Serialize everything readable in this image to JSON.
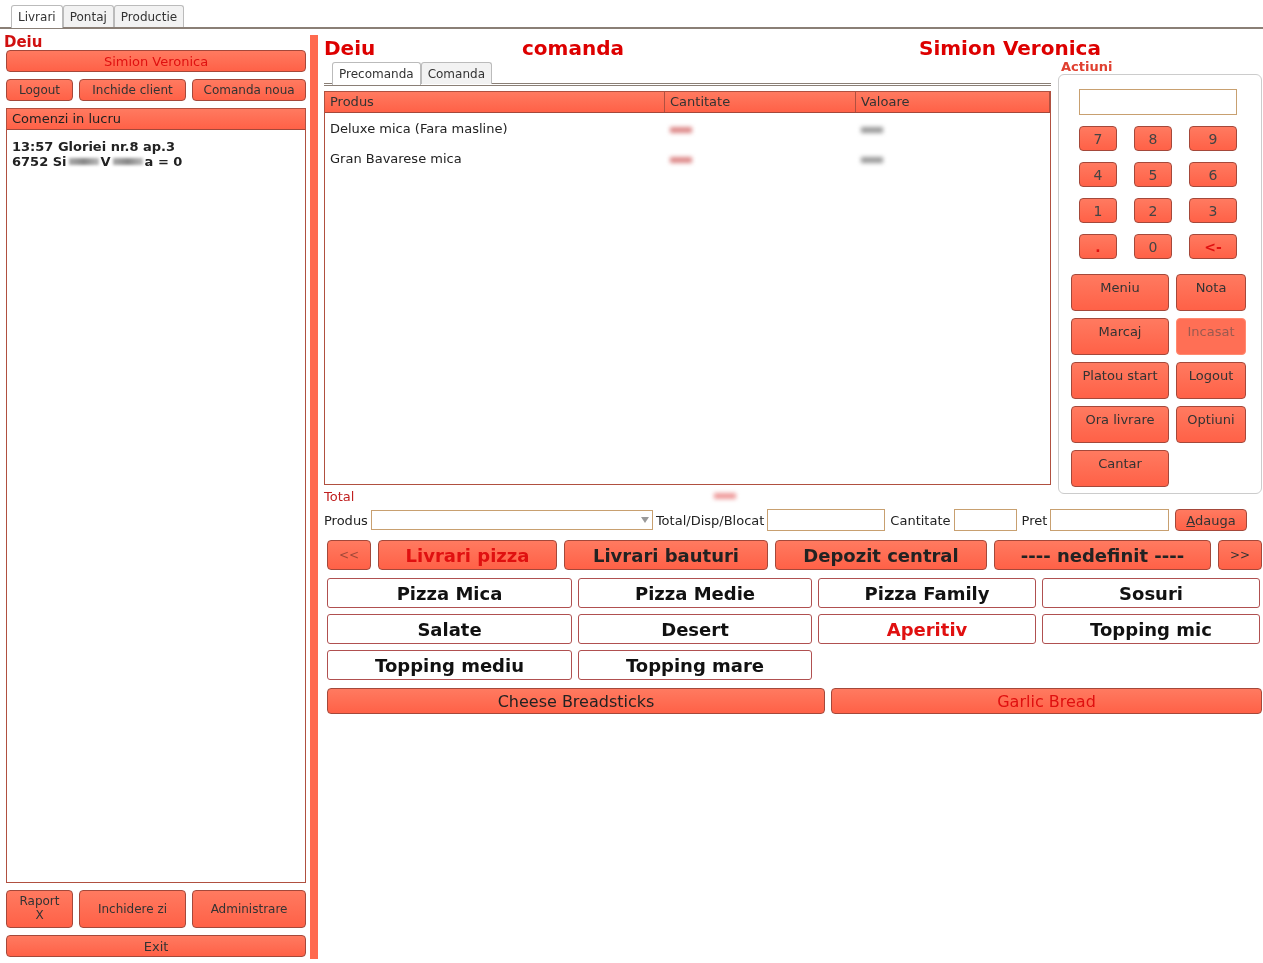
{
  "top_tabs": [
    {
      "label": "Livrari",
      "selected": true
    },
    {
      "label": "Pontaj",
      "selected": false
    },
    {
      "label": "Productie",
      "selected": false
    }
  ],
  "left": {
    "user": "Deiu",
    "operator_button": "Simion Veronica",
    "buttons": [
      "Logout",
      "Inchide client",
      "Comanda noua"
    ],
    "orders_panel": {
      "title": "Comenzi in lucru",
      "orders": [
        {
          "line_1": "13:57 Gloriei nr.8 ap.3",
          "line_2": [
            {
              "kind": "text",
              "text": "6752 Si"
            },
            {
              "kind": "blurred"
            },
            {
              "kind": "text",
              "text": "V"
            },
            {
              "kind": "blurred"
            },
            {
              "kind": "text",
              "text": "a = 0"
            }
          ]
        }
      ]
    },
    "bottom_buttons": [
      "Raport X",
      "Inchidere zi",
      "Administrare"
    ],
    "exit_button": "Exit"
  },
  "header": {
    "user": "Deiu",
    "mode": "comanda",
    "operator": "Simion Veronica"
  },
  "order_tabs": [
    {
      "label": "Precomanda",
      "selected": true
    },
    {
      "label": "Comanda",
      "selected": false
    }
  ],
  "table": {
    "columns": [
      "Produs",
      "Cantitate",
      "Valoare"
    ],
    "rows": [
      {
        "produs": "Deluxe mica (Fara masline)",
        "cantitate": {
          "kind": "blurred"
        },
        "valoare": {
          "kind": "blurred"
        }
      },
      {
        "produs": "Gran Bavarese mica",
        "cantitate": {
          "kind": "blurred"
        },
        "valoare": {
          "kind": "blurred"
        }
      }
    ]
  },
  "total": {
    "label": "Total",
    "value": {
      "kind": "blurred"
    }
  },
  "entry": {
    "produs_label": "Produs",
    "stock_label": "Total/Disp/Blocat",
    "cantitate_label": "Cantitate",
    "pret_label": "Pret",
    "add_button": {
      "label": "Adauga"
    }
  },
  "category_nav": {
    "prev": {
      "label": "<<",
      "disabled": true
    },
    "next": {
      "label": ">>",
      "disabled": false
    },
    "categories": [
      {
        "label": "Livrari pizza",
        "selected": true
      },
      {
        "label": "Livrari bauturi",
        "selected": false
      },
      {
        "label": "Depozit central",
        "selected": false
      },
      {
        "label": "---- nedefinit ----",
        "selected": false
      }
    ]
  },
  "groups": [
    {
      "label": "Pizza Mica",
      "selected": false
    },
    {
      "label": "Pizza Medie",
      "selected": false
    },
    {
      "label": "Pizza Family",
      "selected": false
    },
    {
      "label": "Sosuri",
      "selected": false
    },
    {
      "label": "Salate",
      "selected": false
    },
    {
      "label": "Desert",
      "selected": false
    },
    {
      "label": "Aperitiv",
      "selected": true
    },
    {
      "label": "Topping mic",
      "selected": false
    },
    {
      "label": "Topping mediu",
      "selected": false
    },
    {
      "label": "Topping mare",
      "selected": false
    }
  ],
  "products": [
    {
      "label": "Cheese Breadsticks",
      "selected": false
    },
    {
      "label": "Garlic Bread",
      "selected": true
    }
  ],
  "actions": {
    "title": "Actiuni",
    "keys": [
      {
        "label": "7",
        "kind": "digit"
      },
      {
        "label": "8",
        "kind": "digit"
      },
      {
        "label": "9",
        "kind": "digit"
      },
      {
        "label": "4",
        "kind": "digit"
      },
      {
        "label": "5",
        "kind": "digit"
      },
      {
        "label": "6",
        "kind": "digit"
      },
      {
        "label": "1",
        "kind": "digit"
      },
      {
        "label": "2",
        "kind": "digit"
      },
      {
        "label": "3",
        "kind": "digit"
      },
      {
        "label": ".",
        "kind": "special"
      },
      {
        "label": "0",
        "kind": "digit"
      },
      {
        "label": "<-",
        "kind": "special"
      }
    ],
    "buttons": [
      {
        "label": "Meniu",
        "disabled": false
      },
      {
        "label": "Nota",
        "disabled": false
      },
      {
        "label": "Marcaj",
        "disabled": false
      },
      {
        "label": "Incasat",
        "disabled": true
      },
      {
        "label": "Platou start",
        "disabled": false
      },
      {
        "label": "Logout",
        "disabled": false
      },
      {
        "label": "Ora livrare",
        "disabled": false
      },
      {
        "label": "Optiuni",
        "disabled": false
      },
      {
        "label": "Cantar",
        "disabled": false
      }
    ]
  }
}
